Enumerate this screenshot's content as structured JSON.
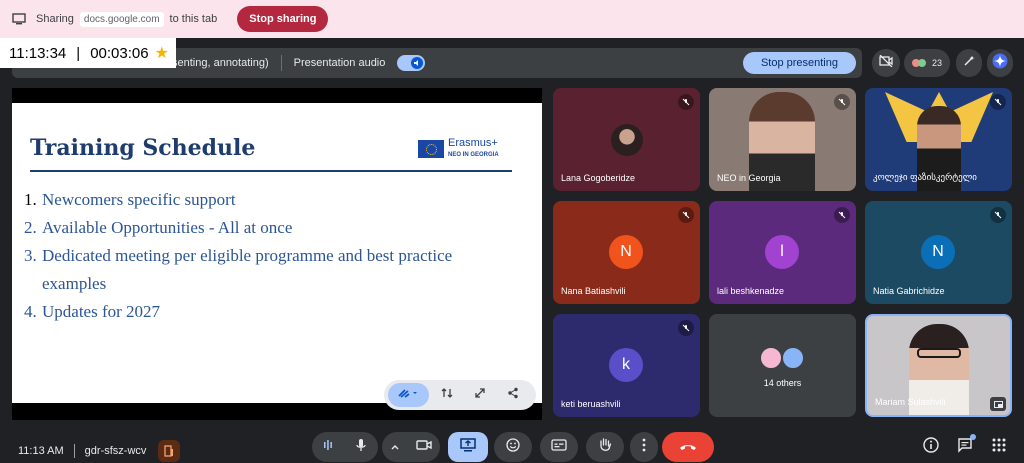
{
  "share_bar": {
    "sharing_label": "Sharing",
    "domain": "docs.google.com",
    "to_tab_label": "to this tab",
    "stop_sharing_label": "Stop sharing"
  },
  "timer": {
    "clock": "11:13:34",
    "separator": "|",
    "elapsed": "00:03:06"
  },
  "presenting_bar": {
    "status_text": "senting, annotating)",
    "audio_label": "Presentation audio",
    "stop_presenting_label": "Stop presenting"
  },
  "participants_count": "23",
  "slide": {
    "title": "Training Schedule",
    "logo_text": "Erasmus+",
    "logo_subtext": "NEO IN GEORGIA",
    "items": [
      {
        "num": "1.",
        "text": "Newcomers specific support"
      },
      {
        "num": "2.",
        "text": "Available Opportunities - All at once"
      },
      {
        "num": "3.",
        "text": "Dedicated meeting per eligible programme and best practice"
      },
      {
        "num": "",
        "text": "examples"
      },
      {
        "num": "4.",
        "text": "Updates for 2027"
      }
    ]
  },
  "tiles": [
    {
      "name": "Lana Gogoberidze"
    },
    {
      "name": "NEO in Georgia"
    },
    {
      "name": "კოლეჯი ფაზისკერტელი"
    },
    {
      "name": "Nana Batiashvili",
      "initial": "N"
    },
    {
      "name": "lali beshkenadze",
      "initial": "l"
    },
    {
      "name": "Natia Gabrichidze",
      "initial": "N"
    },
    {
      "name": "keti beruashvili",
      "initial": "k"
    },
    {
      "name": "14 others"
    },
    {
      "name": "Mariam Sulashvili"
    }
  ],
  "bottom_bar": {
    "time": "11:13 AM",
    "separator": "|",
    "meeting_code": "gdr-sfsz-wcv"
  },
  "colors": {
    "share_bar_bg": "#fce4ec",
    "stop_sharing": "#b3283f",
    "accent_blue": "#a8c7fa",
    "end_call": "#ea4335",
    "slide_title": "#1f3c6e"
  }
}
